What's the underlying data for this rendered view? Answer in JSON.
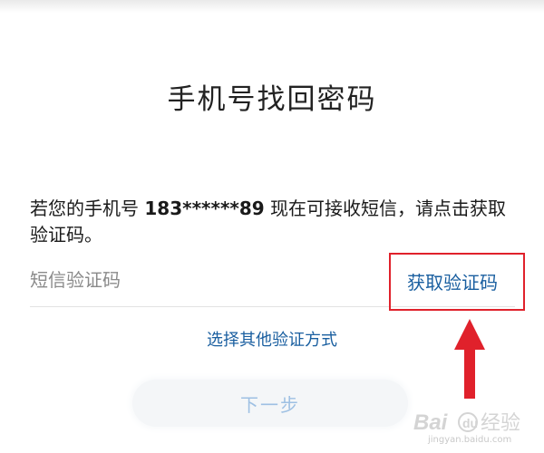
{
  "page": {
    "title": "手机号找回密码"
  },
  "instruction": {
    "prefix": "若您的手机号 ",
    "phone": "183******89",
    "suffix": " 现在可接收短信，请点击获取验证码。"
  },
  "code_field": {
    "placeholder": "短信验证码",
    "value": ""
  },
  "get_code_label": "获取验证码",
  "other_method_label": "选择其他验证方式",
  "next_label": "下一步",
  "watermark": {
    "brand": "Bai",
    "brand_suffix": "经验",
    "url": "jingyan.baidu.com"
  },
  "colors": {
    "highlight": "#e0212b",
    "link": "#1a5fa0",
    "next_text_disabled": "#9ec0e3"
  }
}
